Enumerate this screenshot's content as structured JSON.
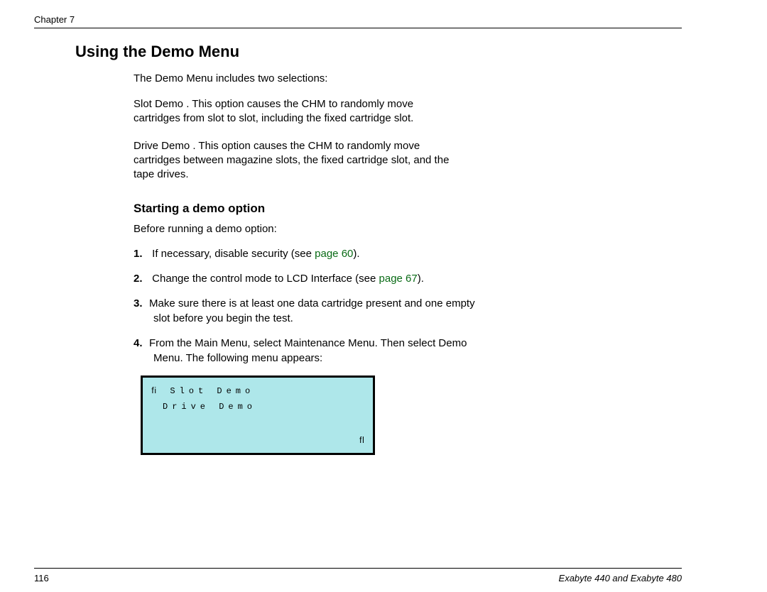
{
  "header": {
    "chapter": "Chapter 7"
  },
  "title": "Using the Demo Menu",
  "intro": "The Demo Menu includes two selections:",
  "items": [
    "Slot Demo . This option causes the CHM to randomly move cartridges from slot to slot, including the fixed cartridge slot.",
    "Drive Demo . This option causes the CHM to randomly move cartridges between magazine slots, the fixed cartridge slot, and the tape drives."
  ],
  "subtitle": "Starting a demo option",
  "before": "Before running a demo option:",
  "steps": {
    "s1a": "If necessary, disable security (see ",
    "s1link": "page 60",
    "s1b": ").",
    "s2a": "Change the control mode to LCD Interface (see ",
    "s2link": "page 67",
    "s2b": ").",
    "s3": "Make sure there is at least one data cartridge present and one empty slot before you begin the test.",
    "s4": "From the Main Menu, select Maintenance Menu. Then select Demo Menu. The following menu appears:"
  },
  "lcd": {
    "line1": "ﬁ Slot  Demo",
    "line2": "Drive  Demo",
    "line3": "ﬂ"
  },
  "footer": {
    "pagenum": "116",
    "booktitle": "Exabyte 440 and Exabyte 480"
  }
}
